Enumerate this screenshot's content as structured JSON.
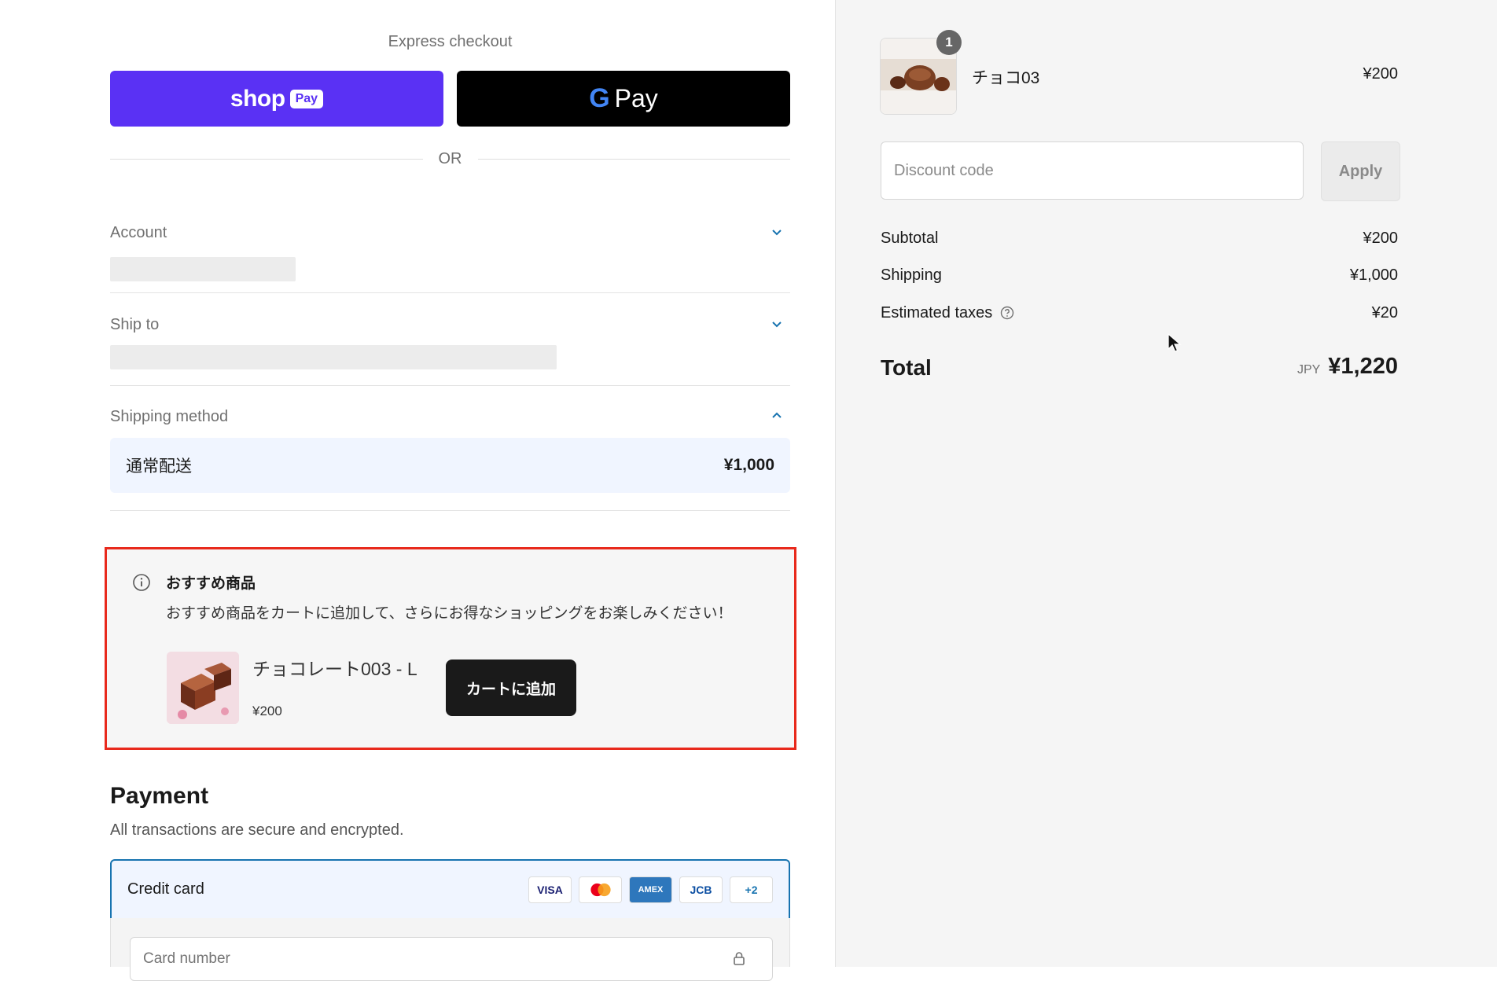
{
  "express": {
    "title": "Express checkout",
    "shop_pay_word": "shop",
    "shop_pay_tag": "Pay",
    "gpay_g": "G",
    "gpay_text": "Pay",
    "or_text": "OR"
  },
  "sections": {
    "account_label": "Account",
    "ship_to_label": "Ship to",
    "shipping_method_label": "Shipping method"
  },
  "shipping_option": {
    "name": "通常配送",
    "price": "¥1,000"
  },
  "recommendation": {
    "title": "おすすめ商品",
    "description": "おすすめ商品をカートに追加して、さらにお得なショッピングをお楽しみください！",
    "product_name": "チョコレート003 - L",
    "product_price": "¥200",
    "add_button": "カートに追加"
  },
  "payment": {
    "title": "Payment",
    "subtitle": "All transactions are secure and encrypted.",
    "method_label": "Credit card",
    "card_logos": [
      "VISA",
      "AMEX",
      "JCB",
      "+2"
    ],
    "card_number_placeholder": "Card number"
  },
  "order": {
    "item_quantity": "1",
    "item_name": "チョコ03",
    "item_price": "¥200",
    "discount_placeholder": "Discount code",
    "apply_label": "Apply",
    "subtotal_label": "Subtotal",
    "subtotal_value": "¥200",
    "shipping_label": "Shipping",
    "shipping_value": "¥1,000",
    "taxes_label": "Estimated taxes",
    "taxes_value": "¥20",
    "total_label": "Total",
    "total_currency": "JPY",
    "total_value": "¥1,220"
  },
  "colors": {
    "shop_pay": "#5a31f4",
    "accent": "#1773b0",
    "highlight_border": "#e8291c"
  }
}
